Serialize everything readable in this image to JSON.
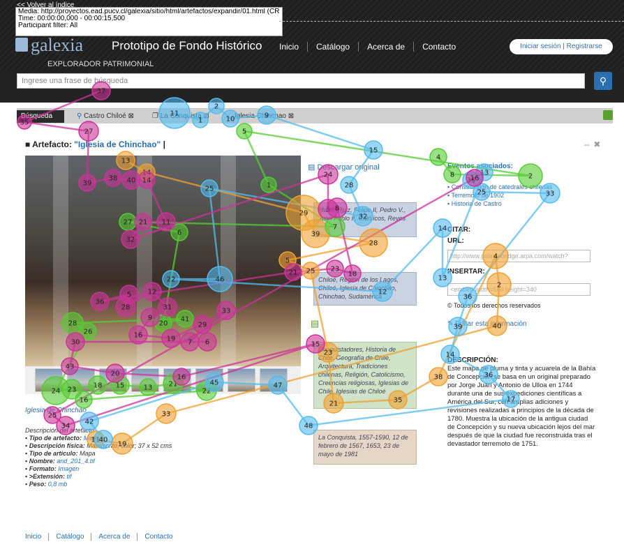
{
  "overlay": {
    "back_link": "<< Volver al índice",
    "media": "Media: http://proyectos.ead.pucv.cl/galexia/sitio/html/artefactos/expandir/01.html (CRC)",
    "time": "Time: 00:00:00,000 - 00:00:15,500",
    "participant": "Participant filter: All"
  },
  "header": {
    "logo": "galexia",
    "site_title": "Prototipo de Fondo Histórico",
    "subtitle": "EXPLORADOR PATRIMONIAL",
    "nav": [
      "Inicio",
      "Catálogo",
      "Acerca de",
      "Contacto"
    ],
    "login": "Iniciar sesión | Registrarse",
    "search_placeholder": "Ingrese una frase de búsqueda"
  },
  "breadcrumbs": [
    "Búsqueda",
    "Castro Chiloé",
    "La Conquista",
    "Iglesia Chinchao"
  ],
  "artifact": {
    "label": "Artefacto:",
    "title": "\"Iglesia de Chinchao\"",
    "sep": "|",
    "download": "Descargar original",
    "caption": "Iglesia de Chinchao"
  },
  "tags": [
    "Martín Ruiz, Felipe II, Pedro V., Juan Pablo II, Católicos, Reyes",
    "Chiloé, Región de los Lagos, Chiloé, Iglesia de Chinchao, Chinchao, Sudamérica",
    "Conquistadores, Historia de Chile, Geografía de Chile, Arquitectura, Tradiciones chilenas, Religión, Catolicismo, Creencias religiosas, Iglesias de Chile, Iglesias de Chiloé",
    "La Conquista, 1557-1590, 12 de febrero de 1567, 1653, 23 de mayo de 1981"
  ],
  "events": {
    "heading": "Eventos asociados:",
    "items": [
      "Construcción de catedrales chilenas",
      "Terremoto de 1902",
      "Historia de Castro"
    ]
  },
  "share": {
    "citar": "CITAR:",
    "url_label": "URL:",
    "url_value": "http://www.galexiabudge.arpa.com/watch?",
    "insertar": "INSERTAR:",
    "insert_value": "<embed width=560 height=340",
    "rights": "© Todos los derechos reservados",
    "edit": "Editar esta información"
  },
  "description": {
    "heading": "DESCRIPCIÓN:",
    "body": "Este mapa de pluma y tinta y acuarela de la Bahía de Concepción se basa en un original preparado por Jorge Juan y Antonio de Ulloa en 1744 durante una de sus expediciones científicas a América del Sur, con amplias adiciones y revisiones realizadas a principios de la década de 1780. Muestra la ubicación de la antigua ciudad de Concepción y su nueva ubicación lejos del mar después de que la ciudad fue reconstruida tras el devastador terremoto de 1751."
  },
  "metadata": {
    "heading": "Descripción del artefacto",
    "rows": [
      {
        "k": "Tipo de artefacto:",
        "v": "Mapa"
      },
      {
        "k": "Descripción física:",
        "v": "Manuscrito, color; 37 x 52 cms"
      },
      {
        "k": "Tipo de artículo:",
        "v": "Mapa"
      },
      {
        "k": "Nombre:",
        "v": "and_201_4.tif"
      },
      {
        "k": "Formato:",
        "v": "Imagen"
      },
      {
        "k": ">Extensión:",
        "v": "tif"
      },
      {
        "k": "Peso:",
        "v": "0,8 mb"
      }
    ]
  },
  "footer": [
    "Inicio",
    "Catálogo",
    "Acerca de",
    "Contacto"
  ],
  "gaze_colors": {
    "pink": "#cc3399",
    "blue": "#55bbee",
    "green": "#55cc33",
    "orange": "#f0a030"
  }
}
